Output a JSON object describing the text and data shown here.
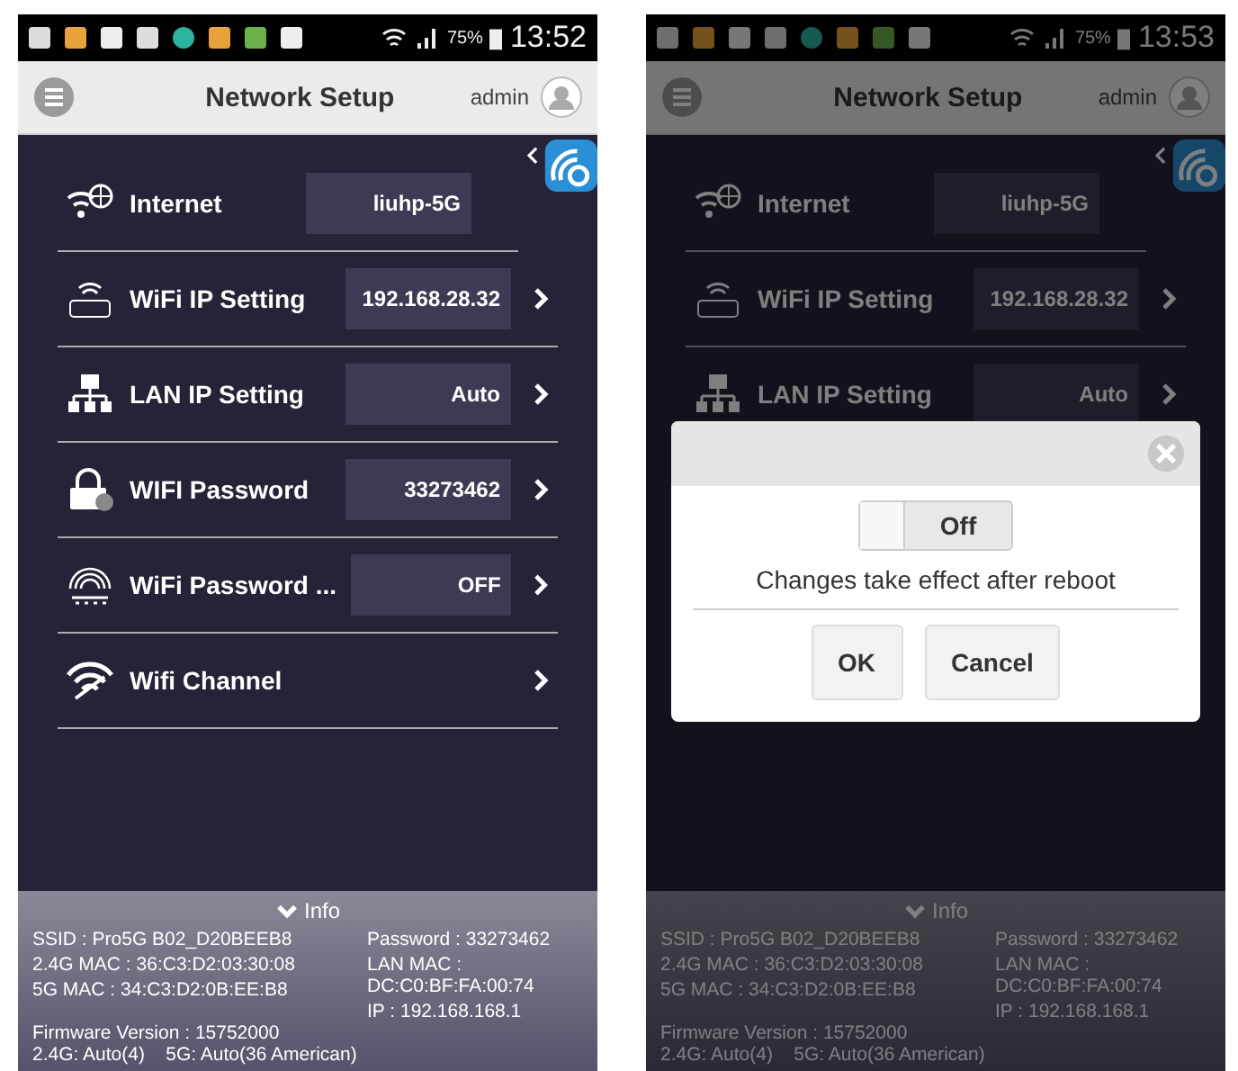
{
  "screens": [
    {
      "status_bar": {
        "battery": "75%",
        "time": "13:52"
      },
      "header": {
        "title": "Network Setup",
        "user": "admin"
      },
      "rows": [
        {
          "label": "Internet",
          "value": "liuhp-5G",
          "chevron": false
        },
        {
          "label": "WiFi IP Setting",
          "value": "192.168.28.32",
          "chevron": true
        },
        {
          "label": "LAN IP Setting",
          "value": "Auto",
          "chevron": true
        },
        {
          "label": "WIFI Password",
          "value": "33273462",
          "chevron": true
        },
        {
          "label": "WiFi Password ...",
          "value": "OFF",
          "chevron": true
        },
        {
          "label": "Wifi Channel",
          "chevron": true
        }
      ],
      "info": {
        "title": "Info",
        "left": [
          "SSID : Pro5G B02_D20BEEB8",
          "2.4G MAC : 36:C3:D2:03:30:08",
          "5G MAC : 34:C3:D2:0B:EE:B8"
        ],
        "right": [
          "Password : 33273462",
          "LAN MAC : DC:C0:BF:FA:00:74",
          "IP : 192.168.168.1"
        ],
        "bottom": [
          "Firmware Version : 15752000",
          "2.4G: Auto(4)    5G: Auto(36 American)"
        ]
      }
    },
    {
      "status_bar": {
        "battery": "75%",
        "time": "13:53"
      },
      "header": {
        "title": "Network Setup",
        "user": "admin"
      },
      "rows": [
        {
          "label": "Internet",
          "value": "liuhp-5G",
          "chevron": false
        },
        {
          "label": "WiFi IP Setting",
          "value": "192.168.28.32",
          "chevron": true
        },
        {
          "label": "LAN IP Setting",
          "value": "Auto",
          "chevron": true
        }
      ],
      "info": {
        "title": "Info",
        "left": [
          "SSID : Pro5G B02_D20BEEB8",
          "2.4G MAC : 36:C3:D2:03:30:08",
          "5G MAC : 34:C3:D2:0B:EE:B8"
        ],
        "right": [
          "Password : 33273462",
          "LAN MAC : DC:C0:BF:FA:00:74",
          "IP : 192.168.168.1"
        ],
        "bottom": [
          "Firmware Version : 15752000",
          "2.4G: Auto(4)    5G: Auto(36 American)"
        ]
      },
      "dialog": {
        "toggle": {
          "label": "Off",
          "on": false
        },
        "message": "Changes take effect after reboot",
        "buttons": [
          "OK",
          "Cancel"
        ]
      }
    }
  ]
}
